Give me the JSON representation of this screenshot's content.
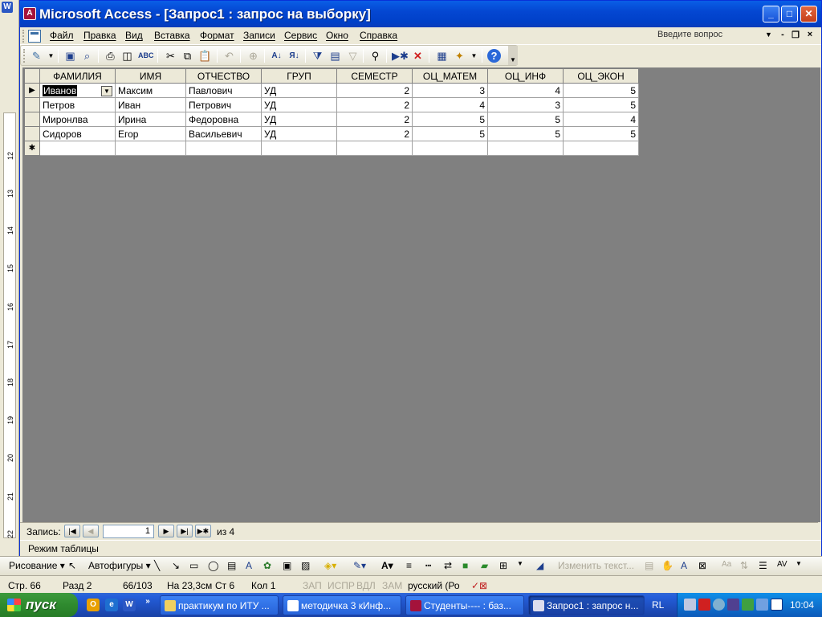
{
  "window": {
    "title": "Microsoft Access - [Запрос1 : запрос на выборку]",
    "min_label": "_",
    "max_label": "□",
    "close_label": "✕"
  },
  "menu": {
    "items": [
      "Файл",
      "Правка",
      "Вид",
      "Вставка",
      "Формат",
      "Записи",
      "Сервис",
      "Окно",
      "Справка"
    ],
    "ask_placeholder": "Введите вопрос",
    "doc_min": "-",
    "doc_restore": "❐",
    "doc_close": "×"
  },
  "toolbar": {
    "icons": [
      "design-view",
      "save",
      "search-file",
      "print",
      "print-preview",
      "spelling",
      "cut",
      "copy",
      "paste",
      "undo",
      "insert-hyperlink",
      "sort-ascending",
      "sort-descending",
      "filter-by-selection",
      "filter-by-form",
      "apply-filter",
      "find",
      "new-record",
      "delete-record",
      "database-window",
      "new-object",
      "help"
    ]
  },
  "datasheet": {
    "columns": [
      "ФАМИЛИЯ",
      "ИМЯ",
      "ОТЧЕСТВО",
      "ГРУП",
      "СЕМЕСТР",
      "ОЦ_МАТЕМ",
      "ОЦ_ИНФ",
      "ОЦ_ЭКОН"
    ],
    "rows": [
      [
        "Иванов",
        "Максим",
        "Павлович",
        "УД",
        "2",
        "3",
        "4",
        "5"
      ],
      [
        "Петров",
        "Иван",
        "Петрович",
        "УД",
        "2",
        "4",
        "3",
        "5"
      ],
      [
        "Миронлва",
        "Ирина",
        "Федоровна",
        "УД",
        "2",
        "5",
        "5",
        "4"
      ],
      [
        "Сидоров",
        "Егор",
        "Васильевич",
        "УД",
        "2",
        "5",
        "5",
        "5"
      ]
    ],
    "current_row_marker": "▶",
    "new_row_marker": "✱"
  },
  "navigation": {
    "label": "Запись:",
    "current": "1",
    "of_text": "из  4"
  },
  "status": {
    "text": "Режим таблицы"
  },
  "word_ruler": {
    "numbers": [
      "12",
      "13",
      "14",
      "15",
      "16",
      "17",
      "18",
      "19",
      "20",
      "21",
      "22"
    ]
  },
  "drawbar": {
    "drawing": "Рисование ▾",
    "autoshapes": "Автофигуры ▾",
    "change_text": "Изменить текст..."
  },
  "word_status": {
    "page": "Стр. 66",
    "section": "Разд 2",
    "pages": "66/103",
    "at": "На 23,3см",
    "line": "Ст 6",
    "col": "Кол 1",
    "rec": "ЗАП",
    "trk": "ИСПР",
    "ext": "ВДЛ",
    "ovr": "ЗАМ",
    "lang": "русский (Ро"
  },
  "taskbar": {
    "start": "пуск",
    "tasks": [
      "практикум по ИТУ ...",
      "методичка 3 кИнф...",
      "Студенты---- : баз...",
      "Запрос1 : запрос н..."
    ],
    "lang": "RL",
    "clock": "10:04",
    "more": "»"
  }
}
